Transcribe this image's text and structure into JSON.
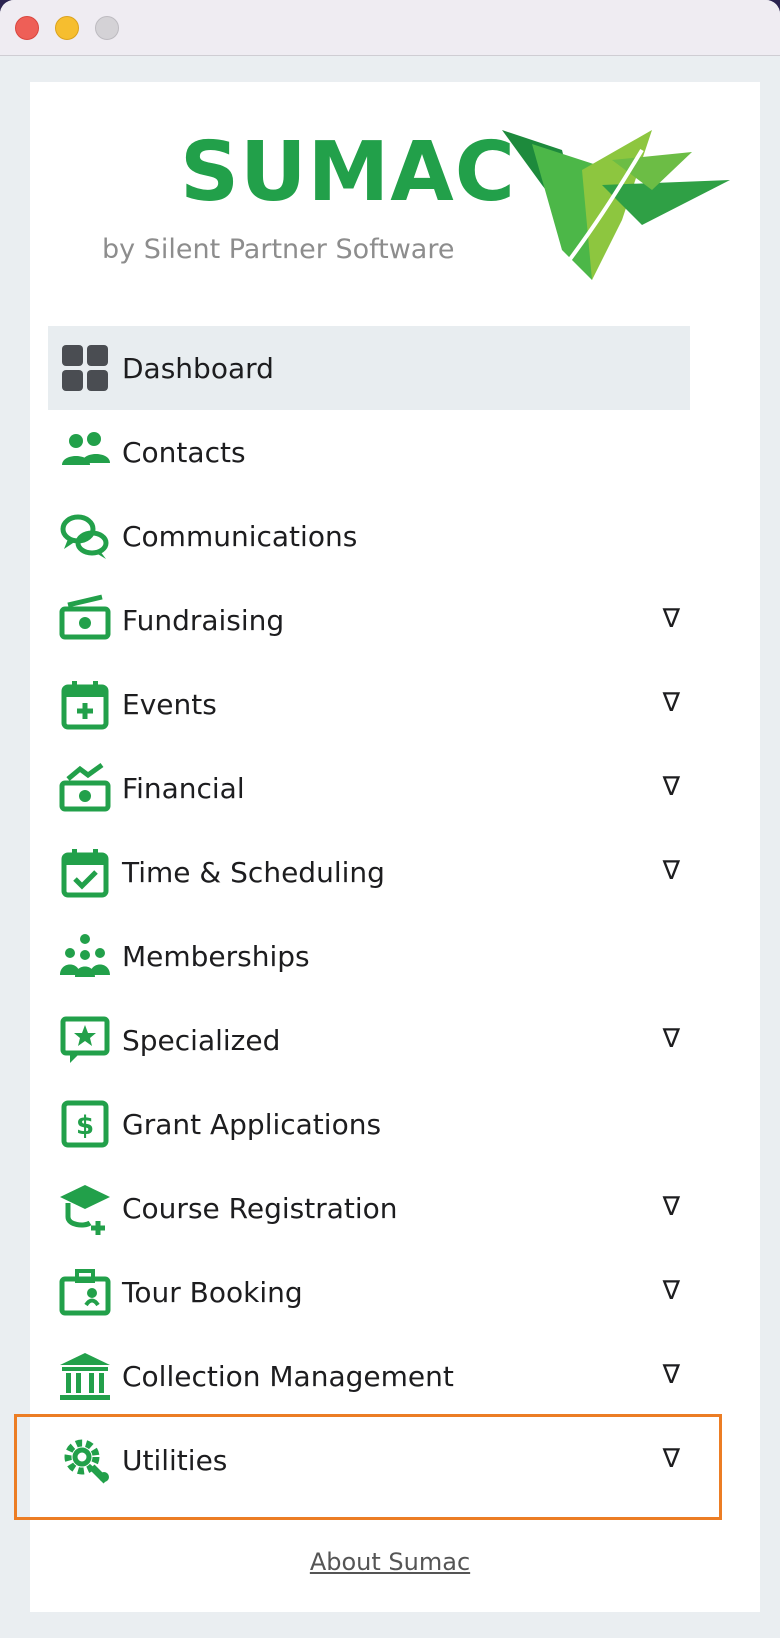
{
  "window": {
    "controls": [
      "close",
      "minimize",
      "maximize"
    ]
  },
  "logo": {
    "wordmark": "SUMAC",
    "tagline": "by Silent Partner Software",
    "brand_color": "#22a04a",
    "icon": "leaf-icon"
  },
  "colors": {
    "accent_green": "#22a04a",
    "active_item_bg": "#e8edf0",
    "highlight_border": "#ec7d24"
  },
  "nav": {
    "active_item": "Dashboard",
    "expand_glyph": "∇",
    "items": [
      {
        "label": "Dashboard",
        "icon": "dashboard-grid-icon",
        "expandable": false
      },
      {
        "label": "Contacts",
        "icon": "people-icon",
        "expandable": false
      },
      {
        "label": "Communications",
        "icon": "chat-bubbles-icon",
        "expandable": false
      },
      {
        "label": "Fundraising",
        "icon": "money-icon",
        "expandable": true
      },
      {
        "label": "Events",
        "icon": "calendar-plus-icon",
        "expandable": true
      },
      {
        "label": "Financial",
        "icon": "money-trend-icon",
        "expandable": true
      },
      {
        "label": "Time & Scheduling",
        "icon": "calendar-check-icon",
        "expandable": true
      },
      {
        "label": "Memberships",
        "icon": "group-icon",
        "expandable": false
      },
      {
        "label": "Specialized",
        "icon": "star-bubble-icon",
        "expandable": true
      },
      {
        "label": "Grant Applications",
        "icon": "dollar-document-icon",
        "expandable": false
      },
      {
        "label": "Course Registration",
        "icon": "graduation-cap-icon",
        "expandable": true
      },
      {
        "label": "Tour Booking",
        "icon": "briefcase-icon",
        "expandable": true
      },
      {
        "label": "Collection Management",
        "icon": "museum-icon",
        "expandable": true
      },
      {
        "label": "Utilities",
        "icon": "gear-wrench-icon",
        "expandable": true
      }
    ]
  },
  "highlighted_item": "Utilities",
  "footer": {
    "about_link": "About Sumac"
  }
}
